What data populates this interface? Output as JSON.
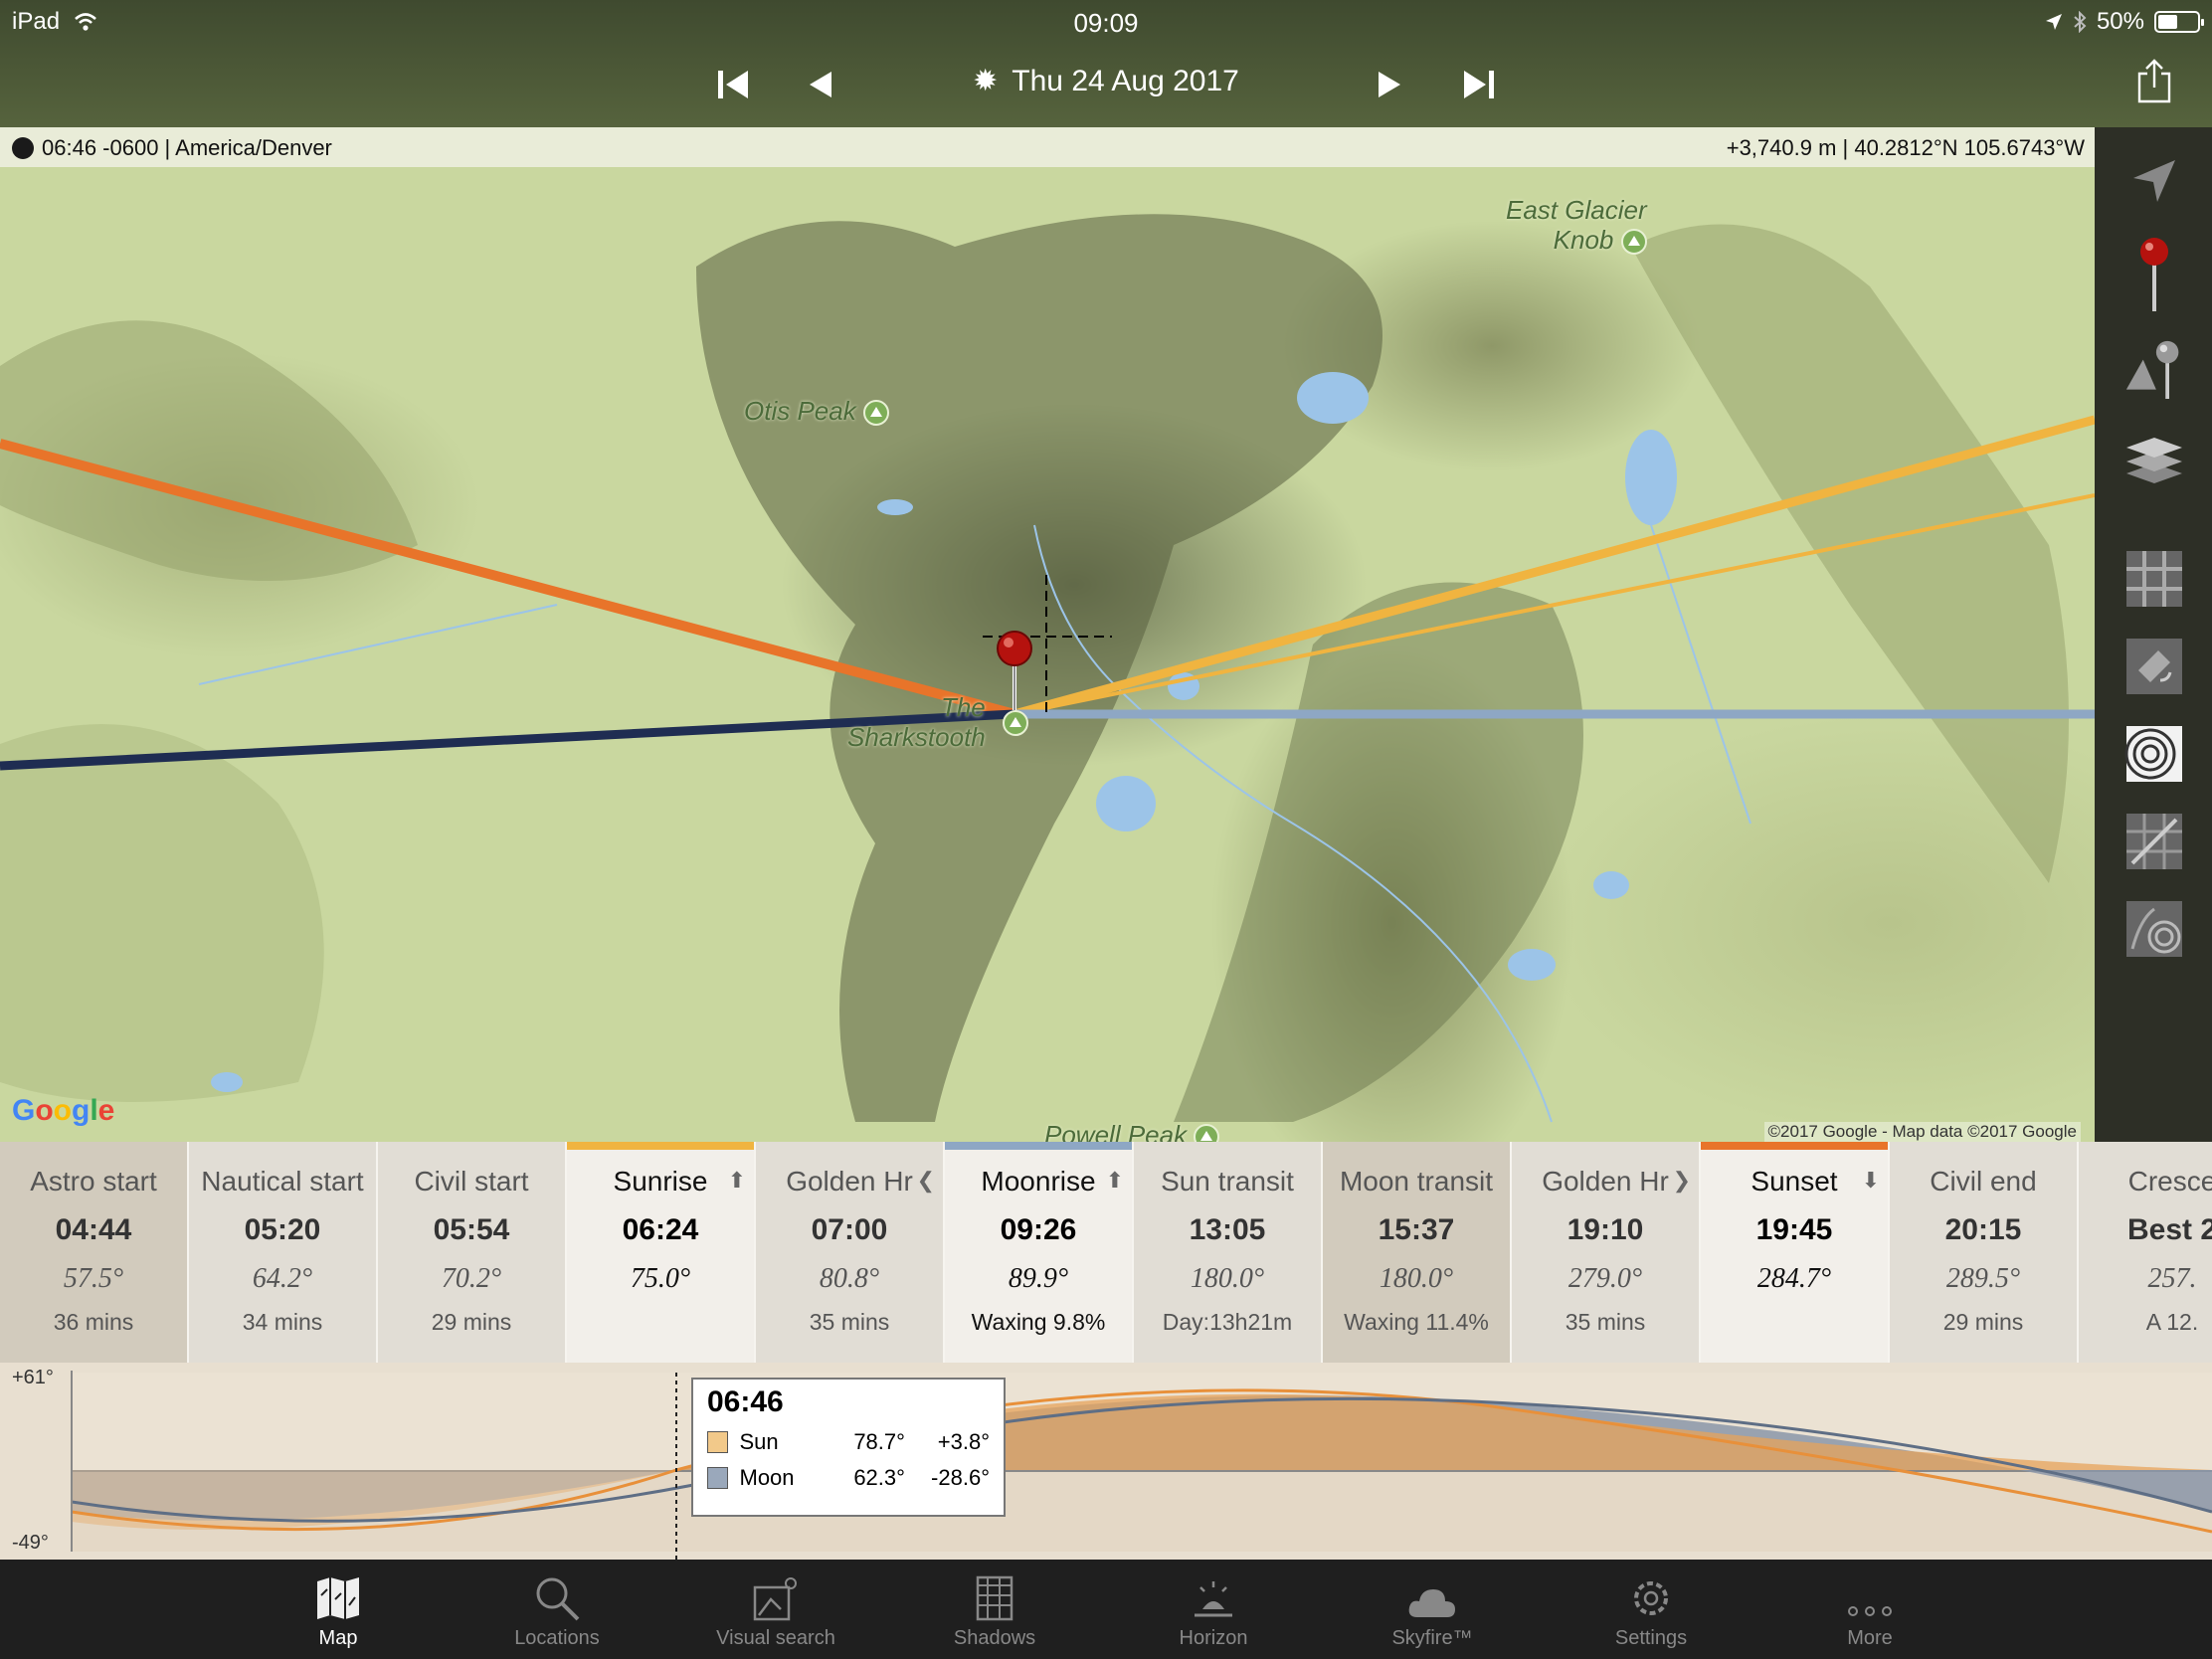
{
  "status_bar": {
    "device": "iPad",
    "time": "09:09",
    "battery": "50%",
    "battery_level": 0.5
  },
  "date_nav": {
    "date": "Thu 24 Aug 2017"
  },
  "map": {
    "info_left": "06:46 -0600 | America/Denver",
    "info_right": "+3,740.9 m | 40.2812°N 105.6743°W",
    "labels": {
      "east_glacier_1": "East Glacier",
      "east_glacier_2": "Knob",
      "otis": "Otis Peak",
      "sharkstooth_1": "The",
      "sharkstooth_2": "Sharkstooth",
      "powell": "Powell Peak"
    },
    "google_logo": "Google",
    "credit": "©2017 Google - Map data ©2017 Google",
    "line_colors": {
      "sunrise": "#f0b440",
      "sunset": "#e8742a",
      "moonrise": "#8ea7c4",
      "moonset": "#1f2d52"
    }
  },
  "tools": [
    "locate-arrow-icon",
    "red-pin-icon",
    "grey-pin-icon",
    "layers-icon",
    "street-map-icon",
    "satellite-icon",
    "topo-icon",
    "hybrid-map-icon",
    "terrain-icon"
  ],
  "events": [
    {
      "name": "Astro start",
      "time": "04:44",
      "az": "57.5°",
      "extra": "36 mins",
      "style": "shaded"
    },
    {
      "name": "Nautical start",
      "time": "05:20",
      "az": "64.2°",
      "extra": "34 mins",
      "style": "normal"
    },
    {
      "name": "Civil start",
      "time": "05:54",
      "az": "70.2°",
      "extra": "29 mins",
      "style": "normal"
    },
    {
      "name": "Sunrise",
      "time": "06:24",
      "az": "75.0°",
      "extra": "",
      "style": "hl",
      "bar": "#f0b440",
      "arrow": "⬆"
    },
    {
      "name": "Golden Hr",
      "time": "07:00",
      "az": "80.8°",
      "extra": "35 mins",
      "style": "normal",
      "arrow": "❮"
    },
    {
      "name": "Moonrise",
      "time": "09:26",
      "az": "89.9°",
      "extra": "Waxing 9.8%",
      "style": "hl",
      "bar": "#8ea7c4",
      "arrow": "⬆"
    },
    {
      "name": "Sun transit",
      "time": "13:05",
      "az": "180.0°",
      "extra": "Day:13h21m",
      "style": "normal"
    },
    {
      "name": "Moon transit",
      "time": "15:37",
      "az": "180.0°",
      "extra": "Waxing 11.4%",
      "style": "shaded"
    },
    {
      "name": "Golden Hr",
      "time": "19:10",
      "az": "279.0°",
      "extra": "35 mins",
      "style": "normal",
      "arrow": "❯"
    },
    {
      "name": "Sunset",
      "time": "19:45",
      "az": "284.7°",
      "extra": "",
      "style": "hl",
      "bar": "#e8742a",
      "arrow": "⬇"
    },
    {
      "name": "Civil end",
      "time": "20:15",
      "az": "289.5°",
      "extra": "29 mins",
      "style": "normal"
    },
    {
      "name": "Cresce",
      "time": "Best 2",
      "az": "257.",
      "extra": "A 12.",
      "style": "normal"
    }
  ],
  "graph": {
    "y_max": "+61°",
    "y_min": "-49°",
    "tooltip": {
      "time": "06:46",
      "sun": {
        "label": "Sun",
        "azimuth": "78.7°",
        "elevation": "+3.8°",
        "color": "#f2c98a"
      },
      "moon": {
        "label": "Moon",
        "azimuth": "62.3°",
        "elevation": "-28.6°",
        "color": "#9aa8bb"
      }
    }
  },
  "tabs": [
    {
      "label": "Map",
      "icon": "map-icon",
      "active": true
    },
    {
      "label": "Locations",
      "icon": "search-icon"
    },
    {
      "label": "Visual search",
      "icon": "visual-search-icon"
    },
    {
      "label": "Shadows",
      "icon": "shadows-icon"
    },
    {
      "label": "Horizon",
      "icon": "horizon-icon"
    },
    {
      "label": "Skyfire™",
      "icon": "cloud-icon"
    },
    {
      "label": "Settings",
      "icon": "gear-icon"
    },
    {
      "label": "More",
      "icon": "more-dots-icon"
    }
  ]
}
